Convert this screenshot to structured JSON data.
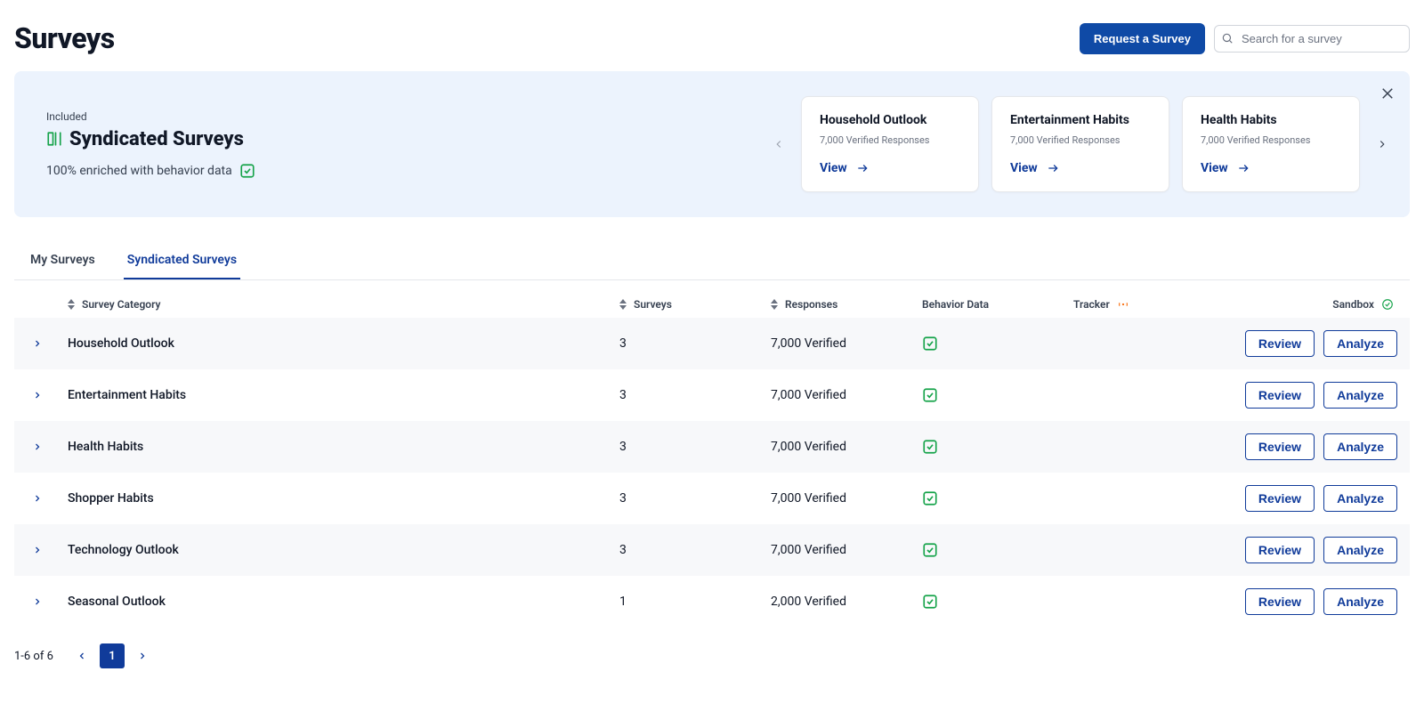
{
  "header": {
    "title": "Surveys",
    "request_button": "Request a Survey",
    "search_placeholder": "Search for a survey"
  },
  "banner": {
    "included_label": "Included",
    "title": "Syndicated Surveys",
    "subtitle": "100% enriched with behavior data",
    "cards": [
      {
        "title": "Household Outlook",
        "meta": "7,000 Verified Responses",
        "view": "View"
      },
      {
        "title": "Entertainment Habits",
        "meta": "7,000 Verified Responses",
        "view": "View"
      },
      {
        "title": "Health Habits",
        "meta": "7,000 Verified Responses",
        "view": "View"
      }
    ]
  },
  "tabs": [
    {
      "label": "My Surveys",
      "active": false
    },
    {
      "label": "Syndicated Surveys",
      "active": true
    }
  ],
  "table": {
    "columns": {
      "category": "Survey Category",
      "surveys": "Surveys",
      "responses": "Responses",
      "behavior": "Behavior Data",
      "tracker": "Tracker",
      "sandbox": "Sandbox"
    },
    "rows": [
      {
        "name": "Household Outlook",
        "surveys": "3",
        "responses": "7,000 Verified"
      },
      {
        "name": "Entertainment Habits",
        "surveys": "3",
        "responses": "7,000 Verified"
      },
      {
        "name": "Health Habits",
        "surveys": "3",
        "responses": "7,000 Verified"
      },
      {
        "name": "Shopper Habits",
        "surveys": "3",
        "responses": "7,000 Verified"
      },
      {
        "name": "Technology Outlook",
        "surveys": "3",
        "responses": "7,000 Verified"
      },
      {
        "name": "Seasonal Outlook",
        "surveys": "1",
        "responses": "2,000 Verified"
      }
    ],
    "actions": {
      "review": "Review",
      "analyze": "Analyze"
    }
  },
  "pagination": {
    "range": "1-6 of 6",
    "current": "1"
  }
}
